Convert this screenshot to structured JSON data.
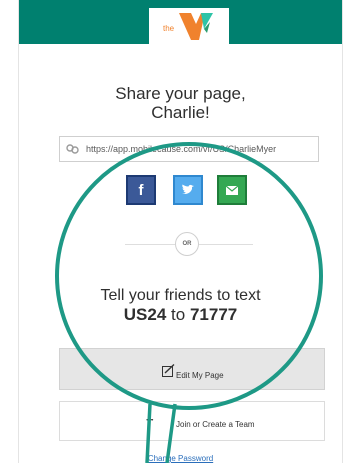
{
  "share": {
    "title_line1": "Share your page,",
    "title_line2": "Charlie!",
    "url": "https://app.mobilecause.com/vf/US/CharlieMyer",
    "or_label": "OR"
  },
  "text_to_give": {
    "line1": "Tell your friends to text",
    "keyword": "US24",
    "to": "to",
    "number": "71777"
  },
  "actions": {
    "edit_label": "Edit My Page",
    "team_label": "Join or Create a Team",
    "change_password": "Change Password"
  },
  "logo": {
    "prefix": "the"
  },
  "colors": {
    "header": "#00806f",
    "callout": "#1e9986",
    "facebook": "#3b5998",
    "twitter": "#55acee",
    "email": "#34a853",
    "link": "#2a6ebb"
  },
  "icons": {
    "url": "link-icon",
    "facebook": "facebook-icon",
    "twitter": "twitter-icon",
    "email": "envelope-icon",
    "edit": "edit-icon",
    "team": "team-icon"
  }
}
